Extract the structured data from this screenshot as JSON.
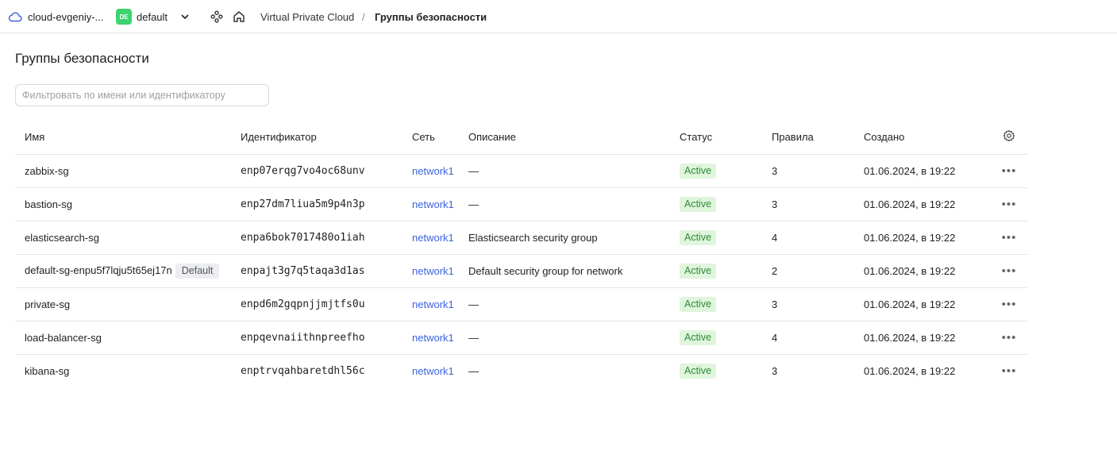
{
  "topbar": {
    "cloud_name": "cloud-evgeniy-...",
    "folder_badge": "DE",
    "folder_name": "default",
    "breadcrumb": {
      "service": "Virtual Private Cloud",
      "separator": "/",
      "current": "Группы безопасности"
    }
  },
  "page": {
    "title": "Группы безопасности",
    "filter_placeholder": "Фильтровать по имени или идентификатору"
  },
  "table": {
    "columns": [
      "Имя",
      "Идентификатор",
      "Сеть",
      "Описание",
      "Статус",
      "Правила",
      "Создано"
    ],
    "rows": [
      {
        "name": "zabbix-sg",
        "default_badge": "",
        "id": "enp07erqg7vo4oc68unv",
        "network": "network1",
        "description": "—",
        "status": "Active",
        "rules": "3",
        "created": "01.06.2024, в 19:22"
      },
      {
        "name": "bastion-sg",
        "default_badge": "",
        "id": "enp27dm7liua5m9p4n3p",
        "network": "network1",
        "description": "—",
        "status": "Active",
        "rules": "3",
        "created": "01.06.2024, в 19:22"
      },
      {
        "name": "elasticsearch-sg",
        "default_badge": "",
        "id": "enpa6bok7017480o1iah",
        "network": "network1",
        "description": "Elasticsearch security group",
        "status": "Active",
        "rules": "4",
        "created": "01.06.2024, в 19:22"
      },
      {
        "name": "default-sg-enpu5f7lqju5t65ej17n",
        "default_badge": "Default",
        "id": "enpajt3g7q5taqa3d1as",
        "network": "network1",
        "description": "Default security group for network",
        "status": "Active",
        "rules": "2",
        "created": "01.06.2024, в 19:22"
      },
      {
        "name": "private-sg",
        "default_badge": "",
        "id": "enpd6m2gqpnjjmjtfs0u",
        "network": "network1",
        "description": "—",
        "status": "Active",
        "rules": "3",
        "created": "01.06.2024, в 19:22"
      },
      {
        "name": "load-balancer-sg",
        "default_badge": "",
        "id": "enpqevnaiithnpreefho",
        "network": "network1",
        "description": "—",
        "status": "Active",
        "rules": "4",
        "created": "01.06.2024, в 19:22"
      },
      {
        "name": "kibana-sg",
        "default_badge": "",
        "id": "enptrvqahbaretdhl56c",
        "network": "network1",
        "description": "—",
        "status": "Active",
        "rules": "3",
        "created": "01.06.2024, в 19:22"
      }
    ],
    "row_actions_icon": "ellipsis-icon",
    "settings_icon": "gear-icon"
  },
  "colors": {
    "link": "#3e63dd",
    "active_badge_bg": "#dff5dc",
    "active_badge_text": "#2f8a3a",
    "folder_badge_bg": "#3dd36f",
    "cloud_icon": "#3e63dd"
  }
}
